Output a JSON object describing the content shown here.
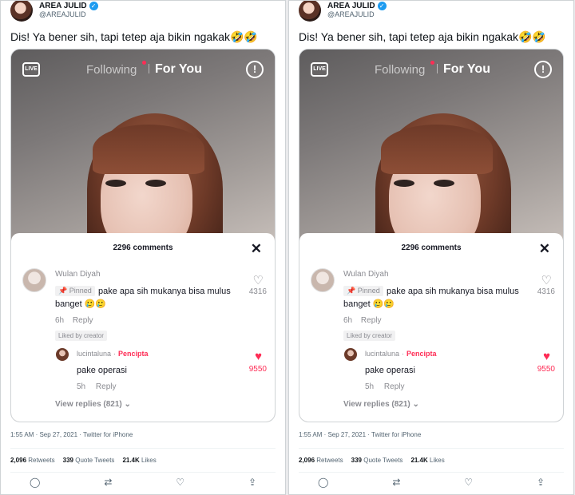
{
  "tweets": [
    {
      "author": {
        "name": "AREA JULID",
        "handle": "@AREAJULID"
      },
      "text": "Dis! Ya bener sih, tapi tetep aja bikin ngakak🤣🤣",
      "tiktok": {
        "live_label": "LIVE",
        "tab_following": "Following",
        "tab_for_you": "For You",
        "comments_count": "2296 comments",
        "comment": {
          "user": "Wulan Diyah",
          "pinned": "Pinned",
          "text": "pake apa sih mukanya bisa mulus banget 🥲🥲",
          "time": "6h",
          "reply": "Reply",
          "liked_by": "Liked by creator",
          "likes": "4316"
        },
        "reply_comment": {
          "user": "lucintaluna",
          "badge": "Pencipta",
          "text": "pake operasi",
          "time": "5h",
          "reply": "Reply",
          "likes": "9550"
        },
        "view_replies": "View replies (821)"
      },
      "timestamp": "1:55 AM · Sep 27, 2021 · Twitter for iPhone",
      "stats": {
        "retweets": "2,096",
        "retweets_label": "Retweets",
        "quotes": "339",
        "quotes_label": "Quote Tweets",
        "likes": "21.4K",
        "likes_label": "Likes"
      }
    },
    {
      "author": {
        "name": "AREA JULID",
        "handle": "@AREAJULID"
      },
      "text": "Dis! Ya bener sih, tapi tetep aja bikin ngakak🤣🤣",
      "tiktok": {
        "live_label": "LIVE",
        "tab_following": "Following",
        "tab_for_you": "For You",
        "comments_count": "2296 comments",
        "comment": {
          "user": "Wulan Diyah",
          "pinned": "Pinned",
          "text": "pake apa sih mukanya bisa mulus banget 🥲🥲",
          "time": "6h",
          "reply": "Reply",
          "liked_by": "Liked by creator",
          "likes": "4316"
        },
        "reply_comment": {
          "user": "lucintaluna",
          "badge": "Pencipta",
          "text": "pake operasi",
          "time": "5h",
          "reply": "Reply",
          "likes": "9550"
        },
        "view_replies": "View replies (821)"
      },
      "timestamp": "1:55 AM · Sep 27, 2021 · Twitter for iPhone",
      "stats": {
        "retweets": "2,096",
        "retweets_label": "Retweets",
        "quotes": "339",
        "quotes_label": "Quote Tweets",
        "likes": "21.4K",
        "likes_label": "Likes"
      }
    }
  ],
  "icons": {
    "verified": "verified-badge-icon",
    "reply": "reply-icon",
    "retweet": "retweet-icon",
    "like": "heart-icon",
    "share": "share-icon"
  },
  "colors": {
    "accent": "#1d9bf0",
    "tiktok_red": "#fe2c55"
  }
}
